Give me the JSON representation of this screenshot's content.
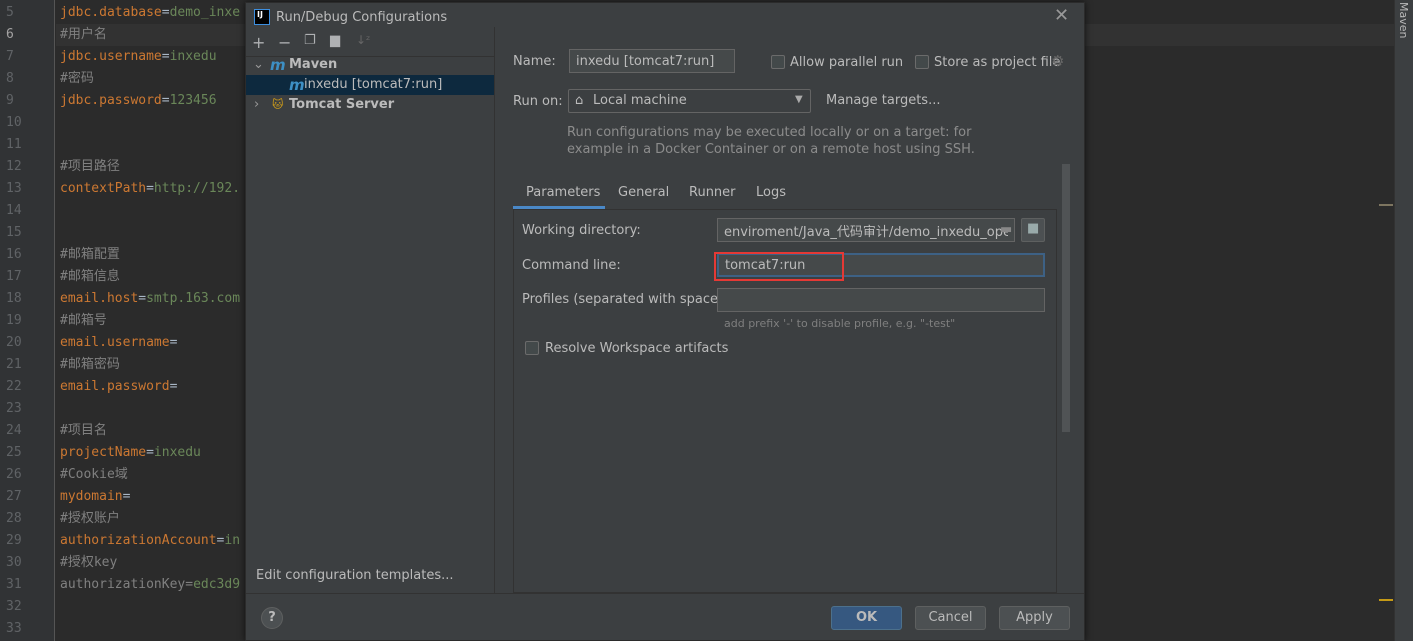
{
  "editor": {
    "current_line": 6,
    "lines": [
      {
        "n": "5",
        "parts": [
          {
            "t": "jdbc.database",
            "c": "#cc7832"
          },
          {
            "t": "=",
            "c": "#a9b7c6"
          },
          {
            "t": "demo_inxe",
            "c": "#6a8759"
          }
        ]
      },
      {
        "n": "6",
        "parts": [
          {
            "t": "#用户名",
            "c": "#808080"
          }
        ]
      },
      {
        "n": "7",
        "parts": [
          {
            "t": "jdbc.username",
            "c": "#cc7832"
          },
          {
            "t": "=",
            "c": "#a9b7c6"
          },
          {
            "t": "inxedu",
            "c": "#6a8759"
          }
        ]
      },
      {
        "n": "8",
        "parts": [
          {
            "t": "#密码",
            "c": "#808080"
          }
        ]
      },
      {
        "n": "9",
        "parts": [
          {
            "t": "jdbc.password",
            "c": "#cc7832"
          },
          {
            "t": "=",
            "c": "#a9b7c6"
          },
          {
            "t": "123456",
            "c": "#6a8759"
          }
        ]
      },
      {
        "n": "10",
        "parts": []
      },
      {
        "n": "11",
        "parts": []
      },
      {
        "n": "12",
        "parts": [
          {
            "t": "#项目路径",
            "c": "#808080"
          }
        ]
      },
      {
        "n": "13",
        "parts": [
          {
            "t": "contextPath",
            "c": "#cc7832"
          },
          {
            "t": "=",
            "c": "#a9b7c6"
          },
          {
            "t": "http://192.",
            "c": "#6a8759"
          }
        ]
      },
      {
        "n": "14",
        "parts": []
      },
      {
        "n": "15",
        "parts": []
      },
      {
        "n": "16",
        "parts": [
          {
            "t": "#邮箱配置",
            "c": "#808080"
          }
        ]
      },
      {
        "n": "17",
        "parts": [
          {
            "t": "#邮箱信息",
            "c": "#808080"
          }
        ]
      },
      {
        "n": "18",
        "parts": [
          {
            "t": "email.host",
            "c": "#cc7832"
          },
          {
            "t": "=",
            "c": "#a9b7c6"
          },
          {
            "t": "smtp.163.com",
            "c": "#6a8759"
          }
        ]
      },
      {
        "n": "19",
        "parts": [
          {
            "t": "#邮箱号",
            "c": "#808080"
          }
        ]
      },
      {
        "n": "20",
        "parts": [
          {
            "t": "email.username",
            "c": "#cc7832"
          },
          {
            "t": "=",
            "c": "#a9b7c6"
          }
        ]
      },
      {
        "n": "21",
        "parts": [
          {
            "t": "#邮箱密码",
            "c": "#808080"
          }
        ]
      },
      {
        "n": "22",
        "parts": [
          {
            "t": "email.password",
            "c": "#cc7832"
          },
          {
            "t": "=",
            "c": "#a9b7c6"
          }
        ]
      },
      {
        "n": "23",
        "parts": []
      },
      {
        "n": "24",
        "parts": [
          {
            "t": "#项目名",
            "c": "#808080"
          }
        ]
      },
      {
        "n": "25",
        "parts": [
          {
            "t": "projectName",
            "c": "#cc7832"
          },
          {
            "t": "=",
            "c": "#a9b7c6"
          },
          {
            "t": "inxedu",
            "c": "#6a8759"
          }
        ]
      },
      {
        "n": "26",
        "parts": [
          {
            "t": "#Cookie域",
            "c": "#808080"
          }
        ]
      },
      {
        "n": "27",
        "parts": [
          {
            "t": "mydomain",
            "c": "#cc7832"
          },
          {
            "t": "=",
            "c": "#a9b7c6"
          }
        ]
      },
      {
        "n": "28",
        "parts": [
          {
            "t": "#授权账户",
            "c": "#808080"
          }
        ]
      },
      {
        "n": "29",
        "parts": [
          {
            "t": "authorizationAccount",
            "c": "#cc7832"
          },
          {
            "t": "=",
            "c": "#a9b7c6"
          },
          {
            "t": "in",
            "c": "#6a8759"
          }
        ]
      },
      {
        "n": "30",
        "parts": [
          {
            "t": "#授权key",
            "c": "#808080"
          }
        ]
      },
      {
        "n": "31",
        "parts": [
          {
            "t": "authorizationKey",
            "c": "#808080"
          },
          {
            "t": "=",
            "c": "#808080"
          },
          {
            "t": "edc3d9",
            "c": "#6a8759"
          }
        ]
      },
      {
        "n": "32",
        "parts": []
      },
      {
        "n": "33",
        "parts": []
      }
    ]
  },
  "right_toolwindow": "Maven",
  "dialog": {
    "title": "Run/Debug Configurations",
    "toolbar": [
      "add-icon",
      "remove-icon",
      "copy-icon",
      "new-folder-icon",
      "sort-icon"
    ],
    "tree": {
      "maven": "Maven",
      "maven_item": "inxedu [tomcat7:run]",
      "tomcat": "Tomcat Server"
    },
    "edit_templates": "Edit configuration templates...",
    "name_label": "Name:",
    "name_value": "inxedu [tomcat7:run]",
    "allow_parallel": "Allow parallel run",
    "store_project": "Store as project file",
    "run_on_label": "Run on:",
    "run_on_value": "Local machine",
    "manage_targets": "Manage targets...",
    "hint1": "Run configurations may be executed locally or on a target: for",
    "hint2": "example in a Docker Container or on a remote host using SSH.",
    "tabs": [
      "Parameters",
      "General",
      "Runner",
      "Logs"
    ],
    "active_tab": "Parameters",
    "workdir_label": "Working directory:",
    "workdir_value": "enviroment/Java_代码审计/demo_inxedu_open",
    "cmd_label": "Command line:",
    "cmd_value": "tomcat7:run",
    "profiles_label": "Profiles (separated with space):",
    "profiles_value": "",
    "profiles_hint": "add prefix '-' to disable profile, e.g. \"-test\"",
    "resolve": "Resolve Workspace artifacts",
    "ok": "OK",
    "cancel": "Cancel",
    "apply": "Apply",
    "accent": "#365880",
    "highlight": "#e53935"
  }
}
